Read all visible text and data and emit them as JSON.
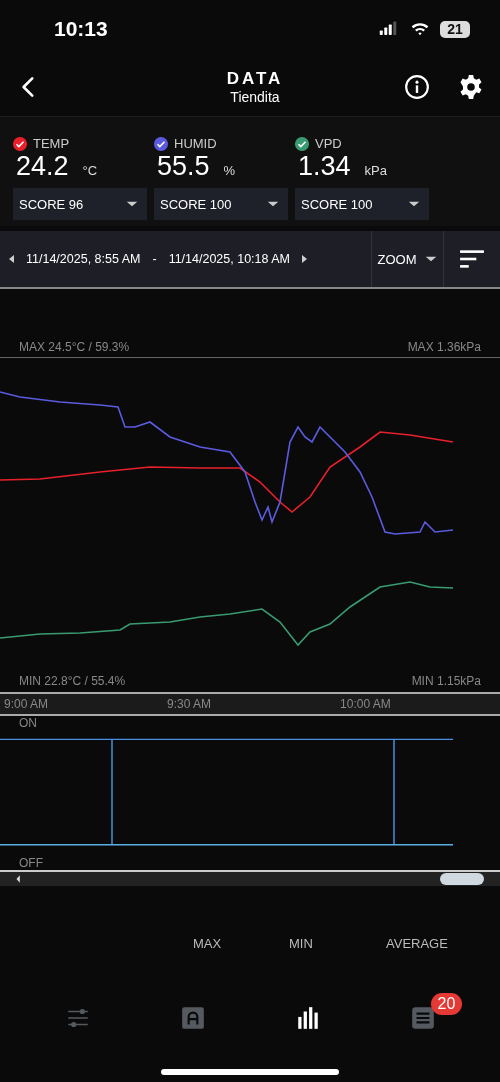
{
  "status_bar": {
    "time": "10:13",
    "battery": "21"
  },
  "header": {
    "title": "DATA",
    "subtitle": "Tiendita"
  },
  "readings": [
    {
      "label": "TEMP",
      "value": "24.2",
      "unit": "°C",
      "checked": true,
      "color": "#e8202a",
      "score": "SCORE 96"
    },
    {
      "label": "HUMID",
      "value": "55.5",
      "unit": "%",
      "checked": true,
      "color": "#5b5be0",
      "score": "SCORE 100"
    },
    {
      "label": "VPD",
      "value": "1.34",
      "unit": "kPa",
      "checked": true,
      "color": "#3a9b72",
      "score": "SCORE 100"
    }
  ],
  "date_range": {
    "start": "11/14/2025, 8:55 AM",
    "separator": "-",
    "end": "11/14/2025, 10:18 AM",
    "zoom": "ZOOM"
  },
  "chart": {
    "max_left": "MAX 24.5°C / 59.3%",
    "max_right": "MAX 1.36kPa",
    "min_left": "MIN 22.8°C / 55.4%",
    "min_right": "MIN 1.15kPa",
    "x_labels": [
      "9:00 AM",
      "9:30 AM",
      "10:00 AM"
    ]
  },
  "switch_chart": {
    "on_label": "ON",
    "off_label": "OFF"
  },
  "stats": {
    "columns": [
      "MAX",
      "MIN",
      "AVERAGE"
    ]
  },
  "tab_bar": [
    {
      "kind": "sliders",
      "selected": false
    },
    {
      "kind": "letter",
      "selected": false
    },
    {
      "kind": "bars",
      "selected": true
    },
    {
      "kind": "list",
      "selected": false,
      "badge": "20"
    }
  ]
}
